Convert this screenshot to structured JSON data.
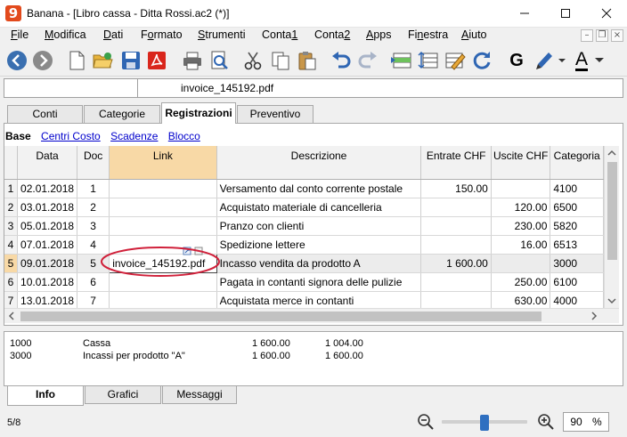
{
  "window": {
    "title": "Banana - [Libro cassa - Ditta Rossi.ac2 (*)]",
    "app_icon_glyph": "9"
  },
  "menu": [
    {
      "label": "File",
      "u": "F"
    },
    {
      "label": "Modifica",
      "u": "M"
    },
    {
      "label": "Dati",
      "u": "D"
    },
    {
      "label": "Formato",
      "u": "o"
    },
    {
      "label": "Strumenti",
      "u": "S"
    },
    {
      "label": "Conta1",
      "u": "1"
    },
    {
      "label": "Conta2",
      "u": "2"
    },
    {
      "label": "Apps",
      "u": "A"
    },
    {
      "label": "Finestra",
      "u": "n"
    },
    {
      "label": "Aiuto",
      "u": "A"
    }
  ],
  "toolbar": {
    "icons": [
      "back-icon",
      "forward-icon",
      "new-file-icon",
      "open-file-icon",
      "save-icon",
      "pdf-icon",
      "print-icon",
      "print-preview-icon",
      "cut-icon",
      "copy-icon",
      "paste-icon",
      "undo-icon",
      "redo-icon",
      "add-rows-icon",
      "move-rows-icon",
      "edit-rows-icon",
      "recheck-icon",
      "bold-icon",
      "highlighter-icon",
      "text-color-icon"
    ],
    "bold_glyph": "G",
    "text_color_glyph": "A"
  },
  "edit_line": {
    "value": "invoice_145192.pdf"
  },
  "tabs": [
    "Conti",
    "Categorie",
    "Registrazioni",
    "Preventivo"
  ],
  "active_tab": "Registrazioni",
  "views": {
    "active": "Base",
    "links": [
      "Centri Costo",
      "Scadenze",
      "Blocco"
    ]
  },
  "table": {
    "columns": [
      "Data",
      "Doc",
      "Link",
      "Descrizione",
      "Entrate CHF",
      "Uscite CHF",
      "Categoria"
    ],
    "rows": [
      {
        "n": "1",
        "data": "02.01.2018",
        "doc": "1",
        "link": "",
        "desc": "Versamento dal conto corrente postale",
        "entrate": "150.00",
        "uscite": "",
        "cat": "4100"
      },
      {
        "n": "2",
        "data": "03.01.2018",
        "doc": "2",
        "link": "",
        "desc": "Acquistato materiale di cancelleria",
        "entrate": "",
        "uscite": "120.00",
        "cat": "6500"
      },
      {
        "n": "3",
        "data": "05.01.2018",
        "doc": "3",
        "link": "",
        "desc": "Pranzo con clienti",
        "entrate": "",
        "uscite": "230.00",
        "cat": "5820"
      },
      {
        "n": "4",
        "data": "07.01.2018",
        "doc": "4",
        "link": "",
        "desc": "Spedizione lettere",
        "entrate": "",
        "uscite": "16.00",
        "cat": "6513"
      },
      {
        "n": "5",
        "data": "09.01.2018",
        "doc": "5",
        "link": "invoice_145192.pdf",
        "desc": "Incasso vendita da prodotto A",
        "entrate": "1 600.00",
        "uscite": "",
        "cat": "3000"
      },
      {
        "n": "6",
        "data": "10.01.2018",
        "doc": "6",
        "link": "",
        "desc": "Pagata in contanti signora delle pulizie",
        "entrate": "",
        "uscite": "250.00",
        "cat": "6100"
      },
      {
        "n": "7",
        "data": "13.01.2018",
        "doc": "7",
        "link": "",
        "desc": "Acquistata merce in contanti",
        "entrate": "",
        "uscite": "630.00",
        "cat": "4000"
      }
    ]
  },
  "info": [
    {
      "account": "1000",
      "name": "Cassa",
      "v1": "1 600.00",
      "v2": "1 004.00"
    },
    {
      "account": "3000",
      "name": "Incassi per prodotto \"A\"",
      "v1": "1 600.00",
      "v2": "1 600.00"
    }
  ],
  "bottom_tabs": [
    "Info",
    "Grafici",
    "Messaggi"
  ],
  "status": {
    "position": "5/8",
    "zoom": "90",
    "zoom_unit": "%",
    "zoom_slider_level": 0.5
  },
  "colors": {
    "accent_orange": "#f8d9a6",
    "annotation_red": "#d0203a",
    "link_blue": "#0000cc",
    "nav_blue": "#3a6fb0"
  }
}
